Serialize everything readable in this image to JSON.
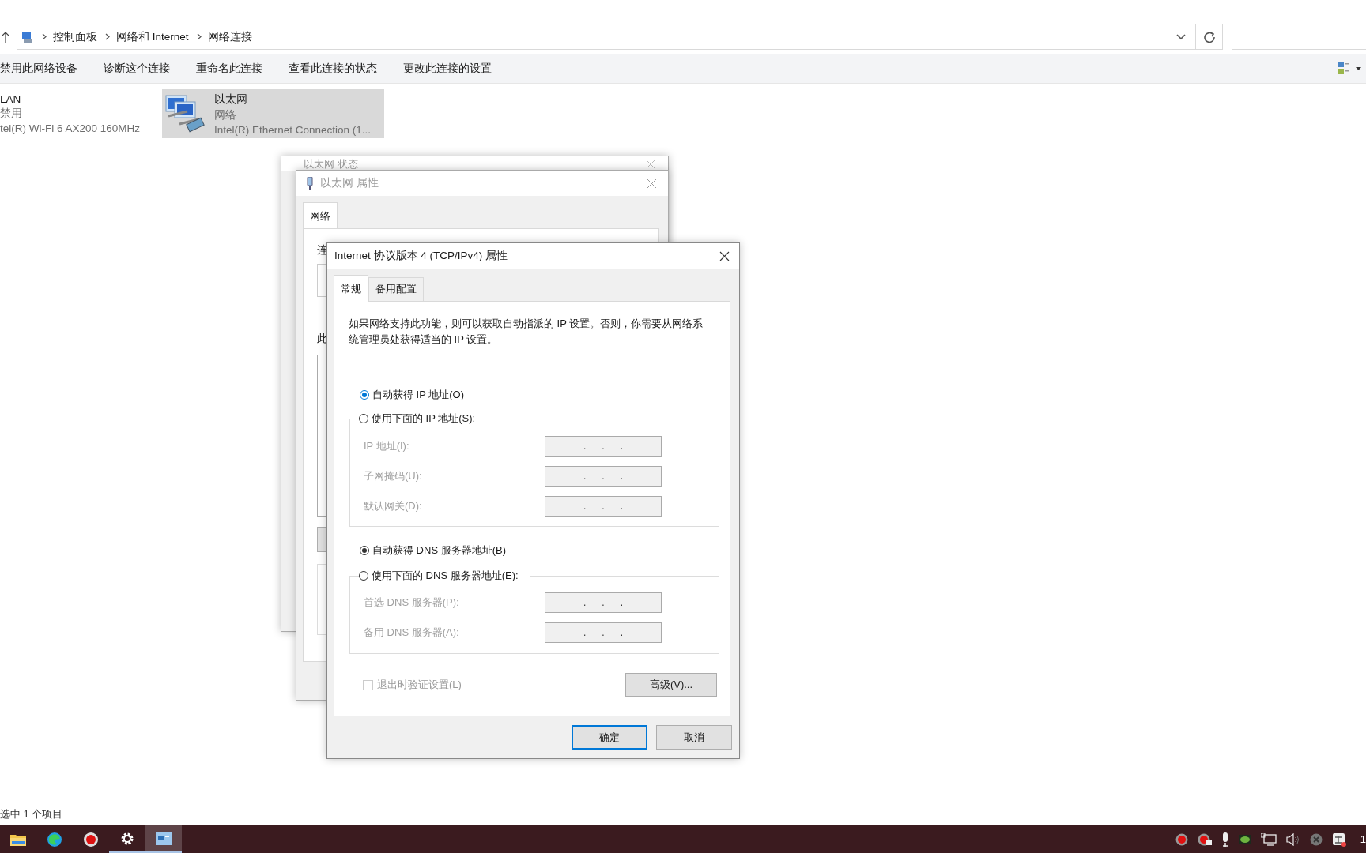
{
  "explorer": {
    "breadcrumb": [
      "控制面板",
      "网络和 Internet",
      "网络连接"
    ],
    "commands": [
      "禁用此网络设备",
      "诊断这个连接",
      "重命名此连接",
      "查看此连接的状态",
      "更改此连接的设置"
    ],
    "items": [
      {
        "name": "LAN",
        "status": "禁用",
        "device": "tel(R) Wi-Fi 6 AX200 160MHz",
        "selected": false
      },
      {
        "name": "以太网",
        "status": "网络",
        "device": "Intel(R) Ethernet Connection (1...",
        "selected": true
      }
    ],
    "status_bar": "选中 1 个项目"
  },
  "status_dialog": {
    "title": "以太网 状态"
  },
  "properties_dialog": {
    "title": "以太网 属性",
    "tabs": [
      {
        "label": "网络",
        "selected": true
      }
    ],
    "fragments": [
      "连",
      "此"
    ]
  },
  "ipv4_dialog": {
    "title": "Internet 协议版本 4 (TCP/IPv4) 属性",
    "tabs": [
      {
        "label": "常规",
        "selected": true
      },
      {
        "label": "备用配置",
        "selected": false
      }
    ],
    "description": "如果网络支持此功能，则可以获取自动指派的 IP 设置。否则，你需要从网络系统管理员处获得适当的 IP 设置。",
    "ip_options": [
      {
        "label": "自动获得 IP 地址(O)",
        "selected": true
      },
      {
        "label": "使用下面的 IP 地址(S):",
        "selected": false
      }
    ],
    "ip_fields": [
      {
        "label": "IP 地址(I):",
        "value": ".      .      .",
        "disabled": true
      },
      {
        "label": "子网掩码(U):",
        "value": ".      .      .",
        "disabled": true
      },
      {
        "label": "默认网关(D):",
        "value": ".      .      .",
        "disabled": true
      }
    ],
    "dns_options": [
      {
        "label": "自动获得 DNS 服务器地址(B)",
        "selected": true
      },
      {
        "label": "使用下面的 DNS 服务器地址(E):",
        "selected": false
      }
    ],
    "dns_fields": [
      {
        "label": "首选 DNS 服务器(P):",
        "value": ".      .      .",
        "disabled": true
      },
      {
        "label": "备用 DNS 服务器(A):",
        "value": ".      .      .",
        "disabled": true
      }
    ],
    "validate_on_exit": {
      "label": "退出时验证设置(L)",
      "checked": false,
      "disabled": true
    },
    "advanced_button": "高级(V)...",
    "buttons": [
      {
        "label": "确定",
        "kind": "default"
      },
      {
        "label": "取消",
        "kind": "normal"
      }
    ]
  },
  "taskbar": {
    "apps": [
      {
        "kind": "folder",
        "running": false,
        "selected": false
      },
      {
        "kind": "browser",
        "running": false,
        "selected": false
      },
      {
        "kind": "record",
        "running": false,
        "selected": false
      },
      {
        "kind": "gear",
        "running": true,
        "selected": false
      },
      {
        "kind": "panel",
        "running": true,
        "selected": true
      }
    ],
    "clock": "1"
  }
}
